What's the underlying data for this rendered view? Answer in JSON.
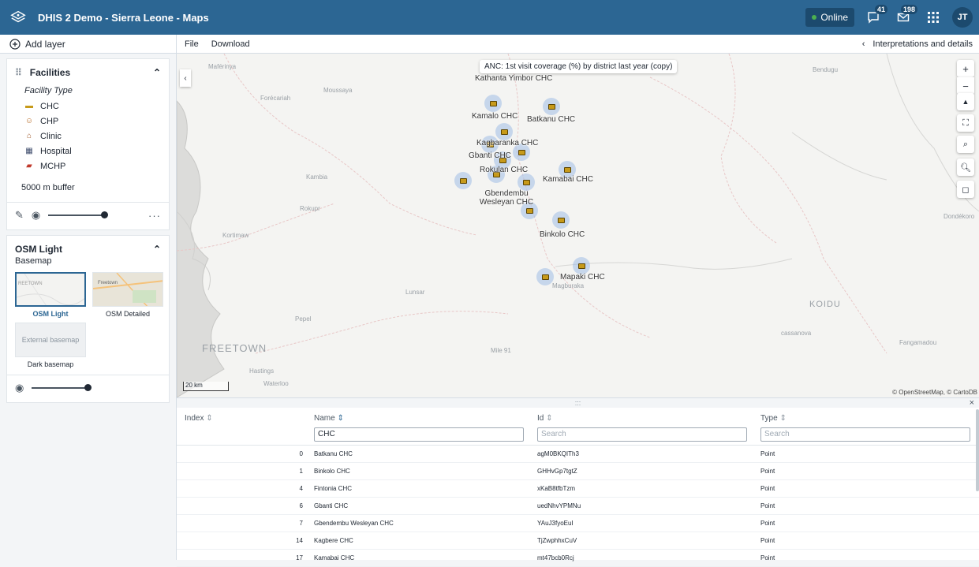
{
  "header": {
    "app_title": "DHIS 2 Demo - Sierra Leone - Maps",
    "online_label": "Online",
    "interpretations_badge": "41",
    "messages_badge": "198",
    "user_initials": "JT"
  },
  "left_panel": {
    "add_layer_label": "Add layer",
    "facilities_layer": {
      "title": "Facilities",
      "legend_title": "Facility Type",
      "legend_items": [
        {
          "label": "CHC",
          "icon": "bus-icon"
        },
        {
          "label": "CHP",
          "icon": "doctor-icon"
        },
        {
          "label": "Clinic",
          "icon": "house-icon"
        },
        {
          "label": "Hospital",
          "icon": "hospital-icon"
        },
        {
          "label": "MCHP",
          "icon": "ambulance-icon"
        }
      ],
      "buffer_label": "5000 m buffer"
    },
    "basemap_layer": {
      "title": "OSM Light",
      "subtitle": "Basemap",
      "options": [
        {
          "label": "OSM Light",
          "thumb_text": "REETOWN"
        },
        {
          "label": "OSM Detailed",
          "thumb_text": "Freetown"
        },
        {
          "label": "Dark basemap",
          "thumb_text": "External basemap"
        }
      ]
    }
  },
  "menubar": {
    "file": "File",
    "download": "Download",
    "interpretations": "Interpretations and details"
  },
  "map": {
    "title": "ANC: 1st visit coverage (%) by district last year (copy)",
    "scale_label": "20 km",
    "attribution": "© OpenStreetMap, © CartoDB",
    "places": [
      "Maférinya",
      "Moussaya",
      "Forécariah",
      "Kambia",
      "Rokupr",
      "Kortimaw",
      "Lunsar",
      "Pepel",
      "FREETOWN",
      "Hastings",
      "Waterloo",
      "Mile 91",
      "Bendugu",
      "Dondékoro",
      "KOIDU",
      "cassanova",
      "Fangamadou",
      "Magburaka"
    ],
    "facility_labels": [
      "Kathanta Yimbor CHC",
      "Kamalo CHC",
      "Batkanu CHC",
      "Kagbaranka CHC",
      "Gbanti CHC",
      "Rokulan CHC",
      "Kamabai CHC",
      "Gbendembu Wesleyan CHC",
      "Binkolo CHC",
      "Mapaki CHC"
    ]
  },
  "table": {
    "columns": [
      {
        "label": "Index",
        "filter": ""
      },
      {
        "label": "Name",
        "filter": "CHC"
      },
      {
        "label": "Id",
        "filter": ""
      },
      {
        "label": "Type",
        "filter": ""
      }
    ],
    "search_placeholder": "Search",
    "rows": [
      {
        "index": "0",
        "name": "Batkanu CHC",
        "id": "agM0BKQITh3",
        "type": "Point"
      },
      {
        "index": "1",
        "name": "Binkolo CHC",
        "id": "GHHvGp7tgtZ",
        "type": "Point"
      },
      {
        "index": "4",
        "name": "Fintonia CHC",
        "id": "xKaB8tfbTzm",
        "type": "Point"
      },
      {
        "index": "6",
        "name": "Gbanti CHC",
        "id": "uedNhvYPMNu",
        "type": "Point"
      },
      {
        "index": "7",
        "name": "Gbendembu Wesleyan CHC",
        "id": "YAuJ3fyoEuI",
        "type": "Point"
      },
      {
        "index": "14",
        "name": "Kagbere CHC",
        "id": "TjZwphhxCuV",
        "type": "Point"
      },
      {
        "index": "17",
        "name": "Kamabai CHC",
        "id": "mt47bcb0Rcj",
        "type": "Point"
      }
    ]
  },
  "colors": {
    "header_bg": "#2c6693",
    "accent": "#2c6693",
    "facility_marker": "#c79a1a"
  }
}
